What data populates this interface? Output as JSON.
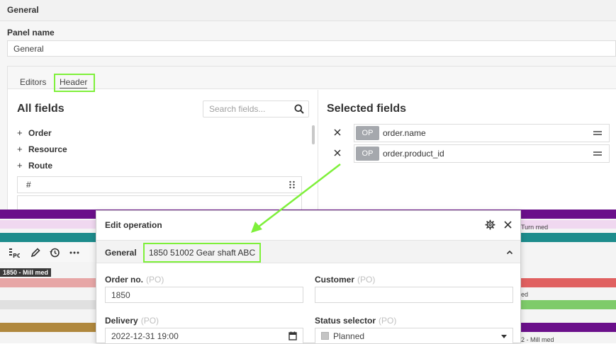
{
  "config": {
    "section_title": "General",
    "panel_name_label": "Panel name",
    "panel_name_value": "General",
    "tabs": [
      {
        "label": "Editors"
      },
      {
        "label": "Header"
      }
    ],
    "all_fields_title": "All fields",
    "search_placeholder": "Search fields...",
    "tree": [
      {
        "label": "Order"
      },
      {
        "label": "Resource"
      },
      {
        "label": "Route"
      }
    ],
    "field_row_label": "#",
    "selected_fields_title": "Selected fields",
    "selected_fields": [
      {
        "badge": "OP",
        "name": "order.name"
      },
      {
        "badge": "OP",
        "name": "order.product_id"
      }
    ]
  },
  "gantt": {
    "row_label": "1850 - Mill med",
    "texts": [
      "Turn med",
      "ed",
      "2 - Mill med"
    ]
  },
  "dialog": {
    "title": "Edit operation",
    "section_label": "General",
    "section_value": "1850 51002 Gear shaft ABC",
    "fields": {
      "order_no": {
        "label": "Order no.",
        "hint": "(PO)",
        "value": "1850"
      },
      "customer": {
        "label": "Customer",
        "hint": "(PO)",
        "value": ""
      },
      "delivery": {
        "label": "Delivery",
        "hint": "(PO)",
        "value": "2022-12-31 19:00"
      },
      "status": {
        "label": "Status selector",
        "hint": "(PO)",
        "value": "Planned"
      }
    }
  },
  "colors": {
    "highlight": "#7ef03a",
    "badge": "#a5a8ad",
    "gantt_purple": "#6a0f8a",
    "gantt_teal": "#1d8c8c",
    "gantt_pink": "#e7a6a6",
    "gantt_green": "#7ecb6a",
    "gantt_brown": "#b0883d"
  }
}
